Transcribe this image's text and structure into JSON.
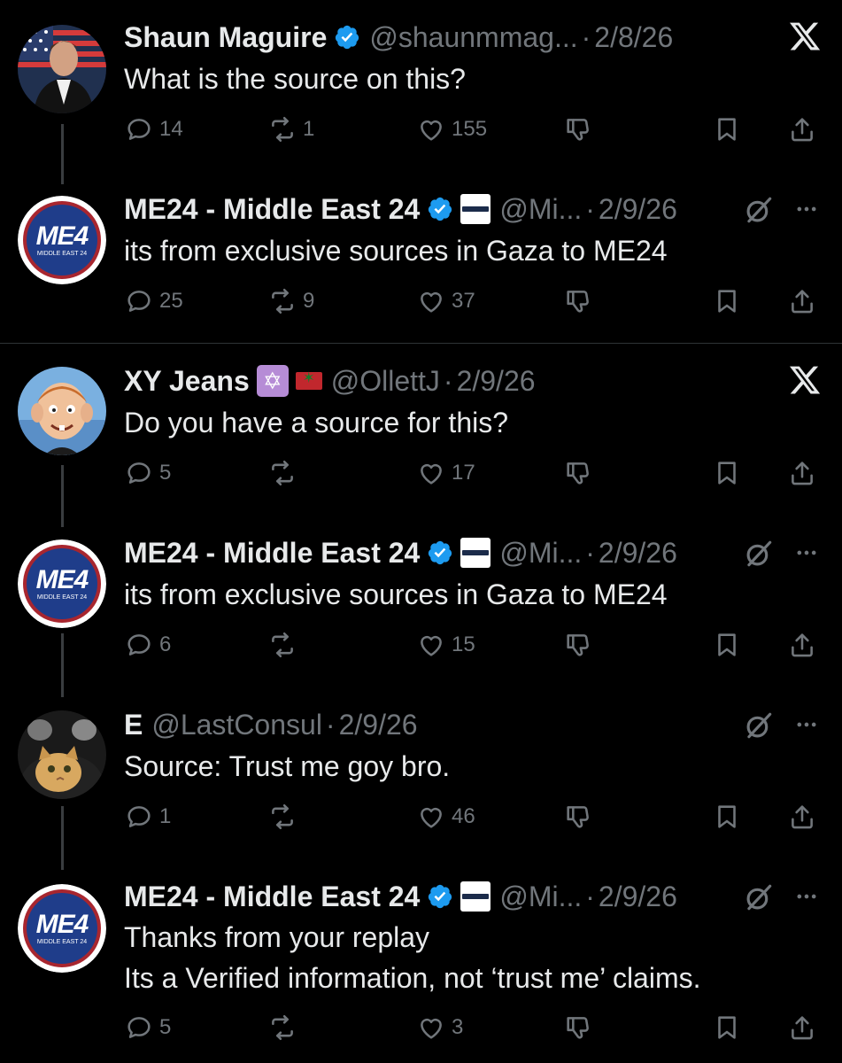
{
  "tweets": [
    {
      "name": "Shaun Maguire",
      "handle": "@shaunmmag...",
      "date": "2/8/26",
      "lines": [
        "What is the source on this?"
      ],
      "replies": "14",
      "reposts": "1",
      "likes": "155"
    },
    {
      "name": "ME24 - Middle East 24",
      "handle": "@Mi...",
      "date": "2/9/26",
      "lines": [
        "its from exclusive sources in Gaza to ME24"
      ],
      "replies": "25",
      "reposts": "9",
      "likes": "37"
    },
    {
      "name": "XY Jeans",
      "handle": "@OllettJ",
      "date": "2/9/26",
      "lines": [
        "Do you have a source for this?"
      ],
      "replies": "5",
      "reposts": "",
      "likes": "17"
    },
    {
      "name": "ME24 - Middle East 24",
      "handle": "@Mi...",
      "date": "2/9/26",
      "lines": [
        "its from exclusive sources in Gaza to ME24"
      ],
      "replies": "6",
      "reposts": "",
      "likes": "15"
    },
    {
      "name": "E",
      "handle": "@LastConsul",
      "date": "2/9/26",
      "lines": [
        "Source: Trust me goy bro."
      ],
      "replies": "1",
      "reposts": "",
      "likes": "46"
    },
    {
      "name": "ME24 - Middle East 24",
      "handle": "@Mi...",
      "date": "2/9/26",
      "lines": [
        "Thanks from your replay",
        "Its a Verified information, not ‘trust me’ claims."
      ],
      "replies": "5",
      "reposts": "",
      "likes": "3"
    }
  ],
  "avatar_labels": {
    "me24_big": "ME4",
    "me24_small": "MIDDLE EAST 24"
  },
  "separator": "·",
  "icons": {
    "x_logo": "x-logo-icon",
    "more": "more-icon",
    "grok": "grok-icon",
    "verified": "verified-badge-icon"
  },
  "colors": {
    "background": "#000000",
    "text": "#e7e9ea",
    "muted": "#71767b",
    "verified": "#1d9bf0",
    "thread_line": "#3a3d40"
  }
}
